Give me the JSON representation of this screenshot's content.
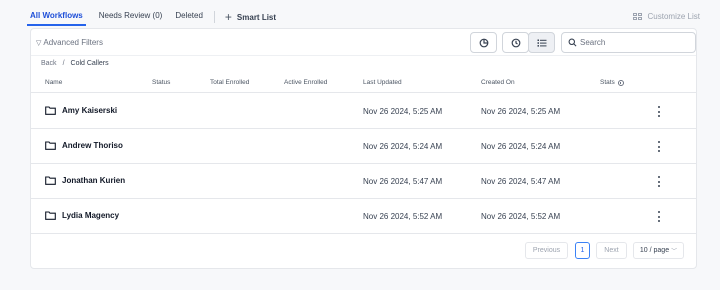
{
  "tabs": [
    {
      "label": "All Workflows",
      "active": true
    },
    {
      "label": "Needs Review (0)",
      "active": false
    },
    {
      "label": "Deleted",
      "active": false
    }
  ],
  "smart_list_label": "Smart List",
  "customize_label": "Customize List",
  "toolbar": {
    "filters_label": "Advanced Filters",
    "search_placeholder": "Search"
  },
  "breadcrumb": {
    "back": "Back",
    "separator": "/",
    "current": "Cold Callers"
  },
  "table": {
    "columns": [
      "Name",
      "Status",
      "Total Enrolled",
      "Active Enrolled",
      "Last Updated",
      "Created On",
      "Stats"
    ],
    "rows": [
      {
        "name": "Amy Kaiserski",
        "last_updated": "Nov 26 2024, 5:25 AM",
        "created_on": "Nov 26 2024, 5:25 AM"
      },
      {
        "name": "Andrew Thoriso",
        "last_updated": "Nov 26 2024, 5:24 AM",
        "created_on": "Nov 26 2024, 5:24 AM"
      },
      {
        "name": "Jonathan Kurien",
        "last_updated": "Nov 26 2024, 5:47 AM",
        "created_on": "Nov 26 2024, 5:47 AM"
      },
      {
        "name": "Lydia Magency",
        "last_updated": "Nov 26 2024, 5:52 AM",
        "created_on": "Nov 26 2024, 5:52 AM"
      }
    ]
  },
  "pagination": {
    "previous": "Previous",
    "current_page": "1",
    "next": "Next",
    "page_size": "10 / page"
  },
  "colors": {
    "accent": "#2563eb",
    "border": "#e5e7eb",
    "background": "#f7f8fa"
  },
  "icons": {
    "folder": "folder-icon",
    "menu": "kebab-menu-icon",
    "stats_info": "info-icon"
  }
}
